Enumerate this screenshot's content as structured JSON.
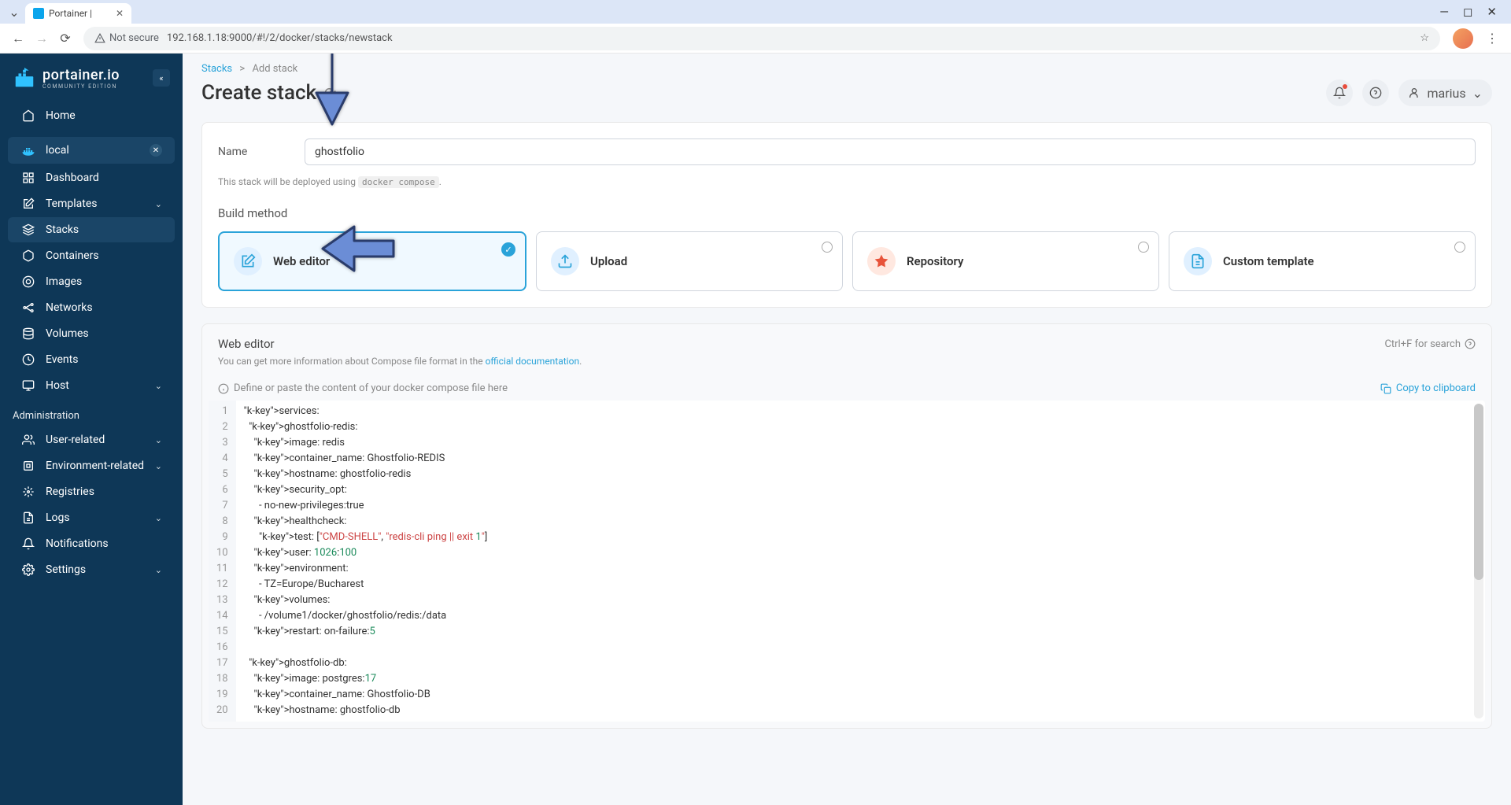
{
  "browser": {
    "tab_title": "Portainer |",
    "url": "192.168.1.18:9000/#!/2/docker/stacks/newstack",
    "security_label": "Not secure"
  },
  "sidebar": {
    "brand": "portainer.io",
    "brand_sub": "COMMUNITY EDITION",
    "home": "Home",
    "env_name": "local",
    "items": [
      {
        "icon": "dashboard",
        "label": "Dashboard"
      },
      {
        "icon": "templates",
        "label": "Templates",
        "chev": true
      },
      {
        "icon": "stacks",
        "label": "Stacks",
        "active": true
      },
      {
        "icon": "containers",
        "label": "Containers"
      },
      {
        "icon": "images",
        "label": "Images"
      },
      {
        "icon": "networks",
        "label": "Networks"
      },
      {
        "icon": "volumes",
        "label": "Volumes"
      },
      {
        "icon": "events",
        "label": "Events"
      },
      {
        "icon": "host",
        "label": "Host",
        "chev": true
      }
    ],
    "admin_label": "Administration",
    "admin_items": [
      {
        "icon": "users",
        "label": "User-related",
        "chev": true
      },
      {
        "icon": "env",
        "label": "Environment-related",
        "chev": true
      },
      {
        "icon": "registries",
        "label": "Registries"
      },
      {
        "icon": "logs",
        "label": "Logs",
        "chev": true
      },
      {
        "icon": "notif",
        "label": "Notifications"
      },
      {
        "icon": "settings",
        "label": "Settings",
        "chev": true
      }
    ]
  },
  "breadcrumb": {
    "root": "Stacks",
    "sep": ">",
    "current": "Add stack"
  },
  "header": {
    "title": "Create stack",
    "user": "marius"
  },
  "form": {
    "name_label": "Name",
    "name_value": "ghostfolio",
    "deploy_note_pre": "This stack will be deployed using ",
    "deploy_note_code": "docker compose",
    "deploy_note_post": ".",
    "build_method_label": "Build method",
    "methods": [
      {
        "key": "web",
        "label": "Web editor",
        "selected": true
      },
      {
        "key": "upload",
        "label": "Upload"
      },
      {
        "key": "repo",
        "label": "Repository"
      },
      {
        "key": "custom",
        "label": "Custom template"
      }
    ]
  },
  "editor": {
    "title": "Web editor",
    "search_hint": "Ctrl+F for search",
    "desc_pre": "You can get more information about Compose file format in the ",
    "desc_link": "official documentation",
    "desc_post": ".",
    "placeholder_hint": "Define or paste the content of your docker compose file here",
    "copy_label": "Copy to clipboard",
    "lines": [
      "services:",
      "  ghostfolio-redis:",
      "    image: redis",
      "    container_name: Ghostfolio-REDIS",
      "    hostname: ghostfolio-redis",
      "    security_opt:",
      "      - no-new-privileges:true",
      "    healthcheck:",
      "      test: [\"CMD-SHELL\", \"redis-cli ping || exit 1\"]",
      "    user: 1026:100",
      "    environment:",
      "      - TZ=Europe/Bucharest",
      "    volumes:",
      "      - /volume1/docker/ghostfolio/redis:/data",
      "    restart: on-failure:5",
      "",
      "  ghostfolio-db:",
      "    image: postgres:17",
      "    container_name: Ghostfolio-DB",
      "    hostname: ghostfolio-db"
    ]
  }
}
